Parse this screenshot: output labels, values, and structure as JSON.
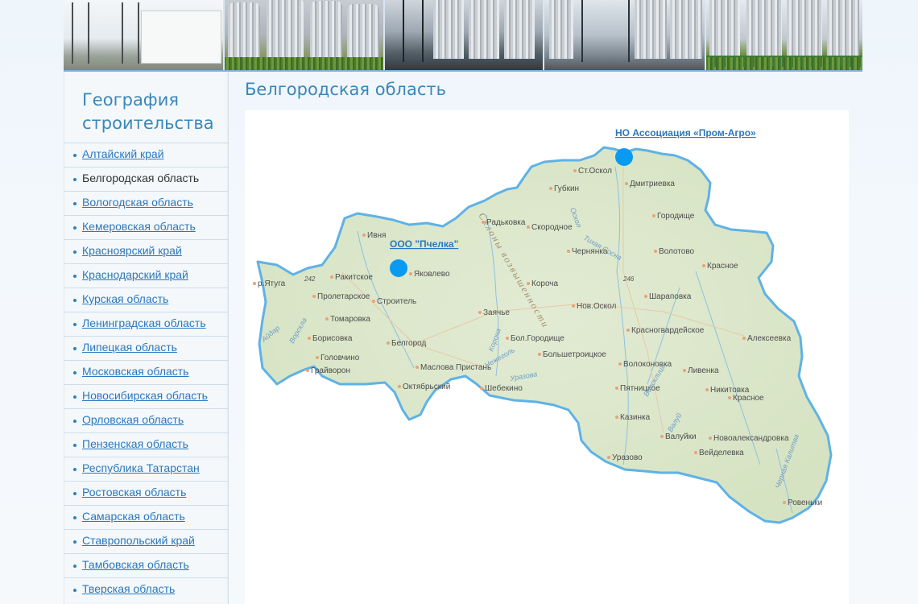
{
  "sidebar": {
    "title": "География строительства",
    "items": [
      {
        "label": "Алтайский край",
        "active": false
      },
      {
        "label": "Белгородская область",
        "active": true
      },
      {
        "label": "Вологодская область",
        "active": false
      },
      {
        "label": "Кемеровская область",
        "active": false
      },
      {
        "label": "Красноярский край",
        "active": false
      },
      {
        "label": "Краснодарский край",
        "active": false
      },
      {
        "label": "Курская область",
        "active": false
      },
      {
        "label": "Ленинградская область",
        "active": false
      },
      {
        "label": "Липецкая область",
        "active": false
      },
      {
        "label": "Московская область",
        "active": false
      },
      {
        "label": "Новосибирская область",
        "active": false
      },
      {
        "label": "Орловская область",
        "active": false
      },
      {
        "label": "Пензенская область",
        "active": false
      },
      {
        "label": "Республика Татарстан",
        "active": false
      },
      {
        "label": "Ростовская область",
        "active": false
      },
      {
        "label": "Самарская область",
        "active": false
      },
      {
        "label": "Ставропольский край",
        "active": false
      },
      {
        "label": "Тамбовская область",
        "active": false
      },
      {
        "label": "Тверская область",
        "active": false
      }
    ]
  },
  "main": {
    "title": "Белгородская область"
  },
  "map": {
    "markers": [
      {
        "label": "НО Ассоциация «Пром-Агро»"
      },
      {
        "label": "ООО \"Пчелка\""
      }
    ],
    "towns": [
      "Ст.Оскол",
      "Губкин",
      "Дмитриевка",
      "Городище",
      "Радьковка",
      "Скородное",
      "Ивня",
      "Чернянка",
      "Волотово",
      "Красное",
      "Ракитское",
      "Яковлево",
      "Короча",
      "р.Ятуга",
      "Пролетарское",
      "Строитель",
      "Нов.Оскол",
      "Шараповка",
      "Томаровка",
      "Заячье",
      "Борисовка",
      "Бол.Городище",
      "Красногвардейское",
      "Алексеевка",
      "Головчино",
      "Белгород",
      "Большетроицкое",
      "Волоконовка",
      "Ливенка",
      "Грайворон",
      "Маслова Пристань",
      "Октябрьский",
      "Шебекино",
      "Пятницкое",
      "Никитовка",
      "Красное",
      "Казинка",
      "Валуйки",
      "Новоалександровка",
      "Уразово",
      "Вейделевка",
      "Ровеньки"
    ],
    "elevations": [
      "242",
      "246"
    ],
    "hills": "Склоны возвышенности",
    "rivers": [
      "Оскол",
      "Ворскла",
      "Короча",
      "Нежеголь",
      "Уразова",
      "Валуй",
      "Тихая Сосна",
      "Айдар",
      "Ворсклица",
      "Черная Калитва"
    ],
    "colors": {
      "land": "#dde8cc",
      "border": "#5fb2e6",
      "marker": "#0a9af2",
      "link": "#2a78bd"
    }
  },
  "banner": {
    "photos": [
      "industrial-building",
      "grain-silos",
      "silo-conveyor",
      "silo-machinery",
      "silos-fence"
    ]
  }
}
